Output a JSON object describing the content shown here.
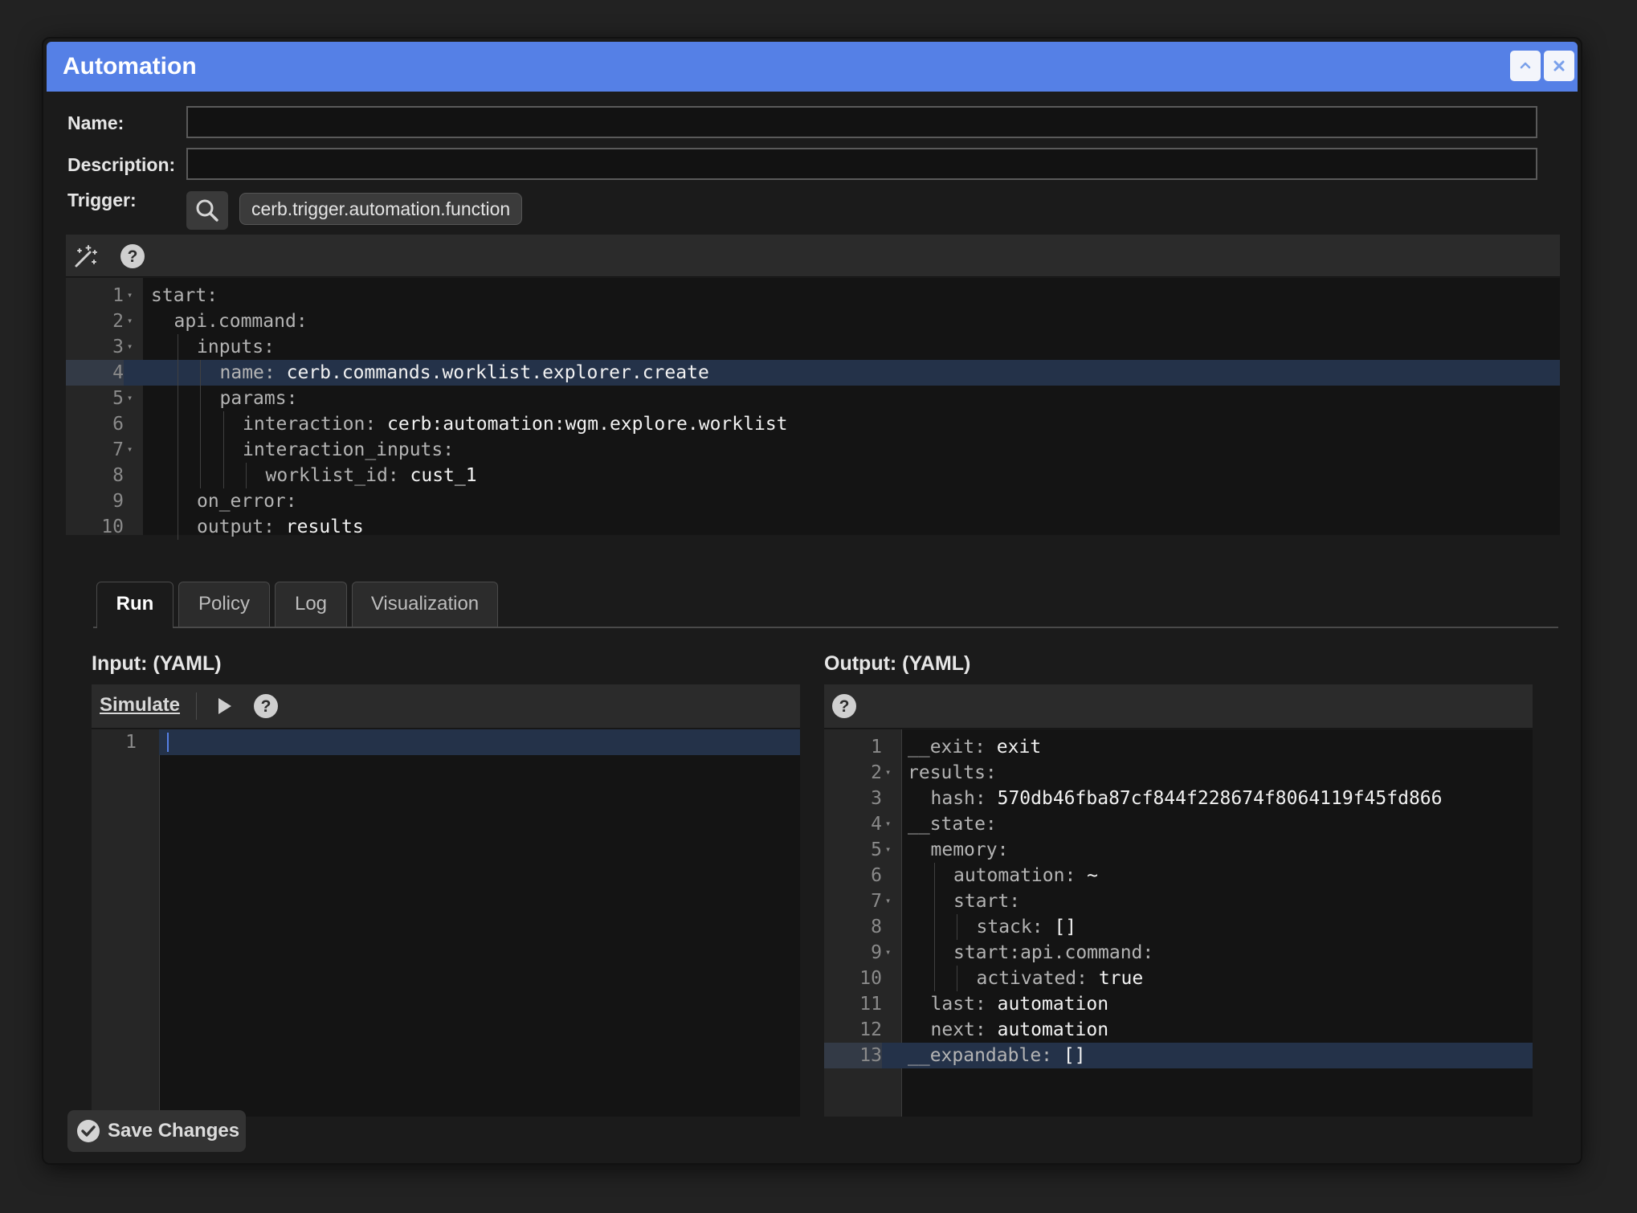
{
  "window": {
    "title": "Automation"
  },
  "form": {
    "name_label": "Name:",
    "name_value": "",
    "description_label": "Description:",
    "description_value": "",
    "trigger_label": "Trigger:",
    "trigger_value": "cerb.trigger.automation.function"
  },
  "script_editor": {
    "lines": [
      {
        "n": "1",
        "indent": 0,
        "key": "start:",
        "value": "",
        "fold": true
      },
      {
        "n": "2",
        "indent": 1,
        "key": "api.command:",
        "value": "",
        "fold": true
      },
      {
        "n": "3",
        "indent": 2,
        "key": "inputs:",
        "value": "",
        "fold": true
      },
      {
        "n": "4",
        "indent": 3,
        "key": "name:",
        "value": " cerb.commands.worklist.explorer.create",
        "fold": false,
        "active": true
      },
      {
        "n": "5",
        "indent": 3,
        "key": "params:",
        "value": "",
        "fold": true
      },
      {
        "n": "6",
        "indent": 4,
        "key": "interaction:",
        "value": " cerb:automation:wgm.explore.worklist",
        "fold": false
      },
      {
        "n": "7",
        "indent": 4,
        "key": "interaction_inputs:",
        "value": "",
        "fold": true
      },
      {
        "n": "8",
        "indent": 5,
        "key": "worklist_id:",
        "value": " cust_1",
        "fold": false
      },
      {
        "n": "9",
        "indent": 2,
        "key": "on_error:",
        "value": "",
        "fold": false
      },
      {
        "n": "10",
        "indent": 2,
        "key": "output:",
        "value": " results",
        "fold": false
      }
    ]
  },
  "tabs": [
    {
      "label": "Run",
      "active": true
    },
    {
      "label": "Policy",
      "active": false
    },
    {
      "label": "Log",
      "active": false
    },
    {
      "label": "Visualization",
      "active": false
    }
  ],
  "run": {
    "input_title": "Input: (YAML)",
    "simulate_label": "Simulate",
    "input_lines": [
      {
        "n": "1"
      }
    ],
    "output_title": "Output: (YAML)",
    "output_lines": [
      {
        "n": "1",
        "indent": 0,
        "key": "__exit:",
        "value": " exit",
        "fold": false
      },
      {
        "n": "2",
        "indent": 0,
        "key": "results:",
        "value": "",
        "fold": true
      },
      {
        "n": "3",
        "indent": 1,
        "key": "hash:",
        "value": " 570db46fba87cf844f228674f8064119f45fd866",
        "fold": false
      },
      {
        "n": "4",
        "indent": 0,
        "key": "__state:",
        "value": "",
        "fold": true
      },
      {
        "n": "5",
        "indent": 1,
        "key": "memory:",
        "value": "",
        "fold": true
      },
      {
        "n": "6",
        "indent": 2,
        "key": "automation:",
        "value": " ~",
        "fold": false
      },
      {
        "n": "7",
        "indent": 2,
        "key": "start:",
        "value": "",
        "fold": true
      },
      {
        "n": "8",
        "indent": 3,
        "key": "stack:",
        "value": " []",
        "fold": false
      },
      {
        "n": "9",
        "indent": 2,
        "key": "start:api.command:",
        "value": "",
        "fold": true
      },
      {
        "n": "10",
        "indent": 3,
        "key": "activated:",
        "value": " true",
        "fold": false
      },
      {
        "n": "11",
        "indent": 1,
        "key": "last:",
        "value": " automation",
        "fold": false
      },
      {
        "n": "12",
        "indent": 1,
        "key": "next:",
        "value": " automation",
        "fold": false
      },
      {
        "n": "13",
        "indent": 0,
        "key": "__expandable:",
        "value": " []",
        "fold": false,
        "active": true
      }
    ]
  },
  "footer": {
    "save_label": "Save Changes"
  },
  "colors": {
    "titlebar": "#5580e6",
    "active_line": "#243249"
  }
}
